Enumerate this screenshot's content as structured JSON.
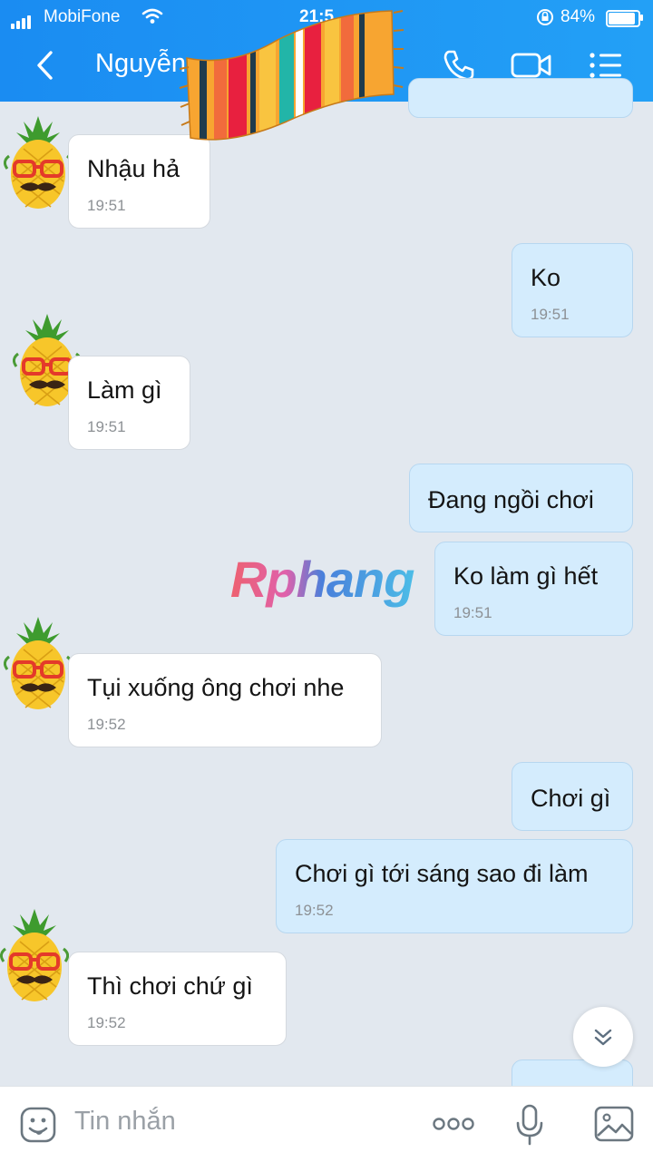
{
  "status_bar": {
    "carrier": "MobiFone",
    "time": "21:5",
    "battery": "84%",
    "battery_level": 0.84
  },
  "header": {
    "contact_name": "Nguyễn",
    "icons": [
      "back-arrow-icon",
      "phone-icon",
      "video-call-icon",
      "menu-list-icon"
    ]
  },
  "messages": [
    {
      "side": "in",
      "text": "Nhậu hả",
      "time": "19:51"
    },
    {
      "side": "out",
      "text": "Ko",
      "time": "19:51"
    },
    {
      "side": "in",
      "text": "Làm gì",
      "time": "19:51"
    },
    {
      "side": "out",
      "text": "Đang ngồi chơi",
      "time": ""
    },
    {
      "side": "out",
      "text": "Ko làm gì hết",
      "time": "19:51"
    },
    {
      "side": "in",
      "text": "Tụi xuống ông chơi nhe",
      "time": "19:52"
    },
    {
      "side": "out",
      "text": "Chơi gì",
      "time": ""
    },
    {
      "side": "out",
      "text": "Chơi gì tới sáng sao đi làm",
      "time": "19:52"
    },
    {
      "side": "in",
      "text": "Thì chơi chứ gì",
      "time": "19:52"
    }
  ],
  "watermark": "Rphang",
  "composer": {
    "placeholder": "Tin nhắn",
    "icons": [
      "sticker-icon",
      "more-icon",
      "microphone-icon",
      "image-icon"
    ]
  },
  "colors": {
    "header": "#1a8cf2",
    "incoming_bubble": "#ffffff",
    "outgoing_bubble": "#d4ecfd",
    "background": "#e2e8ef"
  }
}
